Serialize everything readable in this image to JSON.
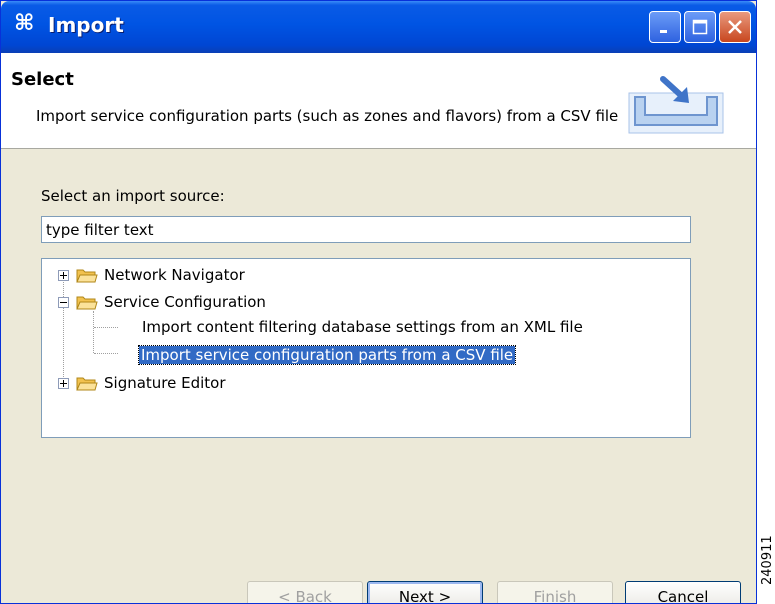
{
  "window": {
    "title": "Import",
    "icon": "import-command-icon",
    "controls": [
      "minimize-icon",
      "maximize-icon",
      "close-icon"
    ]
  },
  "header": {
    "title": "Select",
    "description": "Import service configuration parts (such as zones and flavors) from a CSV file",
    "icon": "import-tray-icon"
  },
  "source": {
    "label": "Select an import source:",
    "filter_value": "type filter text"
  },
  "tree": {
    "items": [
      {
        "label": "Network Navigator",
        "expanded": false
      },
      {
        "label": "Service Configuration",
        "expanded": true,
        "children": [
          {
            "label": "Import content filtering database settings from an XML file"
          },
          {
            "label": "Import service configuration parts from a CSV file",
            "selected": true
          }
        ]
      },
      {
        "label": "Signature Editor",
        "expanded": false
      }
    ]
  },
  "buttons": {
    "back": "< Back",
    "next": "Next >",
    "finish": "Finish",
    "cancel": "Cancel"
  },
  "side_number": "240911",
  "colors": {
    "titlebar": "#0054E3",
    "selection": "#316AC5",
    "dialog_bg": "#ECE9D8"
  }
}
